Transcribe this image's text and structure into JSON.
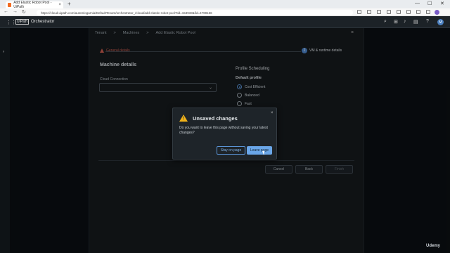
{
  "browser": {
    "tab_title": "Add Elastic Robot Pool - UiPath",
    "tab_close": "×",
    "new_tab": "+",
    "nav": {
      "back": "←",
      "forward": "→",
      "reload": "↻"
    },
    "url": "https://cloud.uipath.com/automlogarnia/DefaultTenant/orchestrator_/cloud/add-elastic-robot-pool?tid=153933&fid=4799166",
    "window_controls": [
      "—",
      "☐",
      "✕"
    ]
  },
  "app": {
    "logo_mark": "UiPath",
    "product": "Orchestrator",
    "user_initial": "M"
  },
  "breadcrumb": [
    "Tenant",
    ">",
    "Machines",
    ">",
    "Add Elastic Robot Pool"
  ],
  "stepper": {
    "step1": "General details",
    "step2_number": "2",
    "step2": "VM & runtime details"
  },
  "machine_details": {
    "title": "Machine details",
    "cloud_connection_label": "Cloud Connection",
    "cloud_connection_value": ""
  },
  "profile": {
    "title": "Profile Scheduling",
    "default_profile_label": "Default profile",
    "options": [
      {
        "label": "Cost Efficient",
        "selected": true
      },
      {
        "label": "Balanced",
        "selected": false
      },
      {
        "label": "Fast",
        "selected": false
      }
    ]
  },
  "footer": {
    "cancel": "Cancel",
    "back": "Back",
    "finish": "Finish"
  },
  "dialog": {
    "title": "Unsaved changes",
    "message": "Do you want to leave this page without saving your latest changes?",
    "stay_label": "Stay on page",
    "leave_label": "Leave page",
    "close": "×"
  },
  "watermark": "Udemy",
  "colors": {
    "accent": "#4a82c7",
    "warning": "#f0b21a",
    "error": "#c65b4e"
  }
}
